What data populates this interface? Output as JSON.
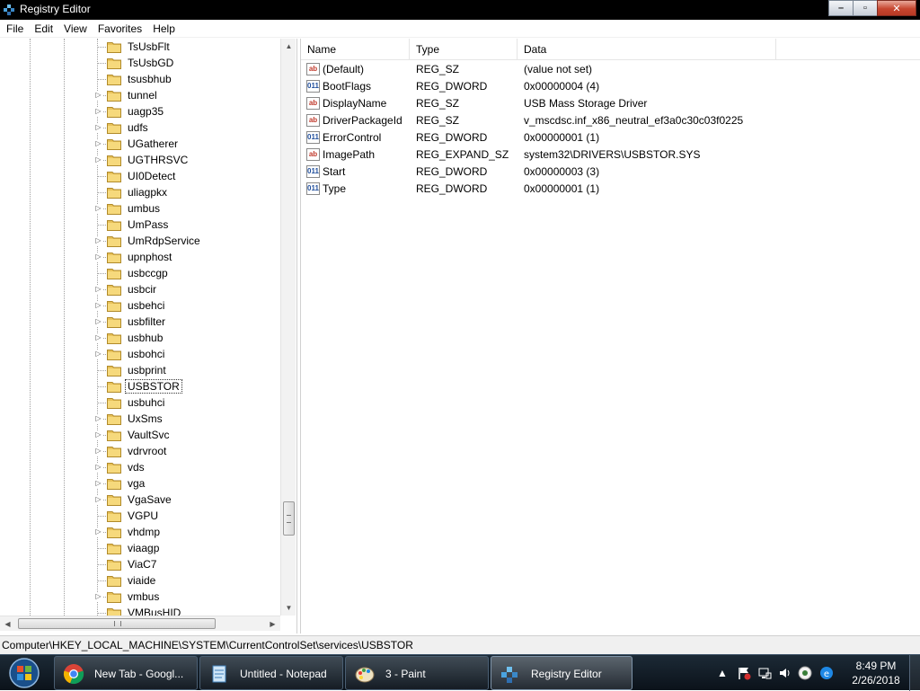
{
  "window": {
    "title": "Registry Editor",
    "icon": "regedit-icon",
    "controls": {
      "minimize": "–",
      "maximize": "▫",
      "close": "✕"
    }
  },
  "menu": {
    "items": [
      "File",
      "Edit",
      "View",
      "Favorites",
      "Help"
    ]
  },
  "tree": {
    "items": [
      {
        "label": "TsUsbFlt",
        "expandable": false
      },
      {
        "label": "TsUsbGD",
        "expandable": false
      },
      {
        "label": "tsusbhub",
        "expandable": false
      },
      {
        "label": "tunnel",
        "expandable": true
      },
      {
        "label": "uagp35",
        "expandable": true
      },
      {
        "label": "udfs",
        "expandable": true
      },
      {
        "label": "UGatherer",
        "expandable": true
      },
      {
        "label": "UGTHRSVC",
        "expandable": true
      },
      {
        "label": "UI0Detect",
        "expandable": false
      },
      {
        "label": "uliagpkx",
        "expandable": false
      },
      {
        "label": "umbus",
        "expandable": true
      },
      {
        "label": "UmPass",
        "expandable": false
      },
      {
        "label": "UmRdpService",
        "expandable": true
      },
      {
        "label": "upnphost",
        "expandable": true
      },
      {
        "label": "usbccgp",
        "expandable": false
      },
      {
        "label": "usbcir",
        "expandable": true
      },
      {
        "label": "usbehci",
        "expandable": true
      },
      {
        "label": "usbfilter",
        "expandable": true
      },
      {
        "label": "usbhub",
        "expandable": true
      },
      {
        "label": "usbohci",
        "expandable": true
      },
      {
        "label": "usbprint",
        "expandable": false
      },
      {
        "label": "USBSTOR",
        "expandable": false,
        "selected": true
      },
      {
        "label": "usbuhci",
        "expandable": false
      },
      {
        "label": "UxSms",
        "expandable": true
      },
      {
        "label": "VaultSvc",
        "expandable": true
      },
      {
        "label": "vdrvroot",
        "expandable": true
      },
      {
        "label": "vds",
        "expandable": true
      },
      {
        "label": "vga",
        "expandable": true
      },
      {
        "label": "VgaSave",
        "expandable": true
      },
      {
        "label": "VGPU",
        "expandable": false
      },
      {
        "label": "vhdmp",
        "expandable": true
      },
      {
        "label": "viaagp",
        "expandable": false
      },
      {
        "label": "ViaC7",
        "expandable": false
      },
      {
        "label": "viaide",
        "expandable": false
      },
      {
        "label": "vmbus",
        "expandable": true
      },
      {
        "label": "VMBusHID",
        "expandable": false
      }
    ]
  },
  "list": {
    "columns": [
      "Name",
      "Type",
      "Data"
    ],
    "rows": [
      {
        "name": "(Default)",
        "type": "REG_SZ",
        "data": "(value not set)",
        "kind": "sz"
      },
      {
        "name": "BootFlags",
        "type": "REG_DWORD",
        "data": "0x00000004 (4)",
        "kind": "bin"
      },
      {
        "name": "DisplayName",
        "type": "REG_SZ",
        "data": "USB Mass Storage Driver",
        "kind": "sz"
      },
      {
        "name": "DriverPackageId",
        "type": "REG_SZ",
        "data": "v_mscdsc.inf_x86_neutral_ef3a0c30c03f0225",
        "kind": "sz"
      },
      {
        "name": "ErrorControl",
        "type": "REG_DWORD",
        "data": "0x00000001 (1)",
        "kind": "bin"
      },
      {
        "name": "ImagePath",
        "type": "REG_EXPAND_SZ",
        "data": "system32\\DRIVERS\\USBSTOR.SYS",
        "kind": "sz"
      },
      {
        "name": "Start",
        "type": "REG_DWORD",
        "data": "0x00000003 (3)",
        "kind": "bin"
      },
      {
        "name": "Type",
        "type": "REG_DWORD",
        "data": "0x00000001 (1)",
        "kind": "bin"
      }
    ]
  },
  "status": {
    "path": "Computer\\HKEY_LOCAL_MACHINE\\SYSTEM\\CurrentControlSet\\services\\USBSTOR"
  },
  "taskbar": {
    "buttons": [
      {
        "label": "New Tab - Googl...",
        "icon": "chrome-icon"
      },
      {
        "label": "Untitled - Notepad",
        "icon": "notepad-icon"
      },
      {
        "label": "3 - Paint",
        "icon": "paint-icon"
      },
      {
        "label": "Registry Editor",
        "icon": "regedit-icon",
        "active": true
      }
    ],
    "clock": {
      "time": "8:49 PM",
      "date": "2/26/2018"
    }
  },
  "colors": {
    "titlebar": "#000000",
    "taskbar": "#0b121a",
    "folder": "#e8c25a"
  }
}
